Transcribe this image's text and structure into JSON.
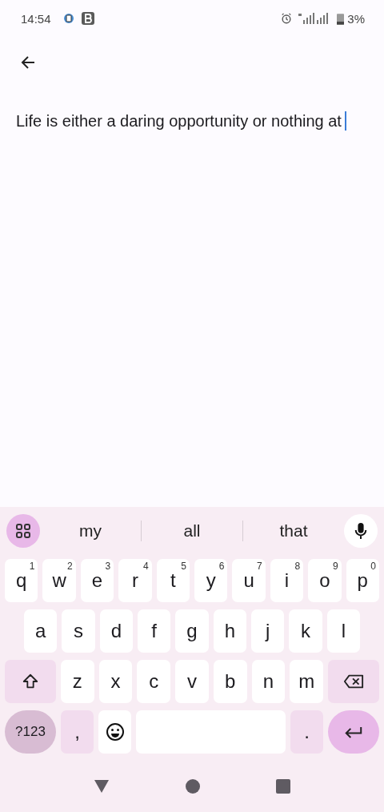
{
  "status_bar": {
    "time": "14:54",
    "battery": "3%"
  },
  "editor": {
    "text": "Life is either a daring opportunity or nothing at"
  },
  "keyboard": {
    "suggestions": [
      "my",
      "all",
      "that"
    ],
    "rows": [
      {
        "keys": [
          {
            "label": "q",
            "hint": "1"
          },
          {
            "label": "w",
            "hint": "2"
          },
          {
            "label": "e",
            "hint": "3"
          },
          {
            "label": "r",
            "hint": "4"
          },
          {
            "label": "t",
            "hint": "5"
          },
          {
            "label": "y",
            "hint": "6"
          },
          {
            "label": "u",
            "hint": "7"
          },
          {
            "label": "i",
            "hint": "8"
          },
          {
            "label": "o",
            "hint": "9"
          },
          {
            "label": "p",
            "hint": "0"
          }
        ]
      },
      {
        "keys": [
          {
            "label": "a"
          },
          {
            "label": "s"
          },
          {
            "label": "d"
          },
          {
            "label": "f"
          },
          {
            "label": "g"
          },
          {
            "label": "h"
          },
          {
            "label": "j"
          },
          {
            "label": "k"
          },
          {
            "label": "l"
          }
        ]
      },
      {
        "keys": [
          {
            "kind": "shift"
          },
          {
            "label": "z"
          },
          {
            "label": "x"
          },
          {
            "label": "c"
          },
          {
            "label": "v"
          },
          {
            "label": "b"
          },
          {
            "label": "n"
          },
          {
            "label": "m"
          },
          {
            "kind": "backspace"
          }
        ]
      },
      {
        "keys": [
          {
            "kind": "symbols",
            "label": "?123"
          },
          {
            "kind": "punct",
            "label": ","
          },
          {
            "kind": "emoji"
          },
          {
            "kind": "space"
          },
          {
            "kind": "punct",
            "label": "."
          },
          {
            "kind": "enter"
          }
        ]
      }
    ]
  }
}
